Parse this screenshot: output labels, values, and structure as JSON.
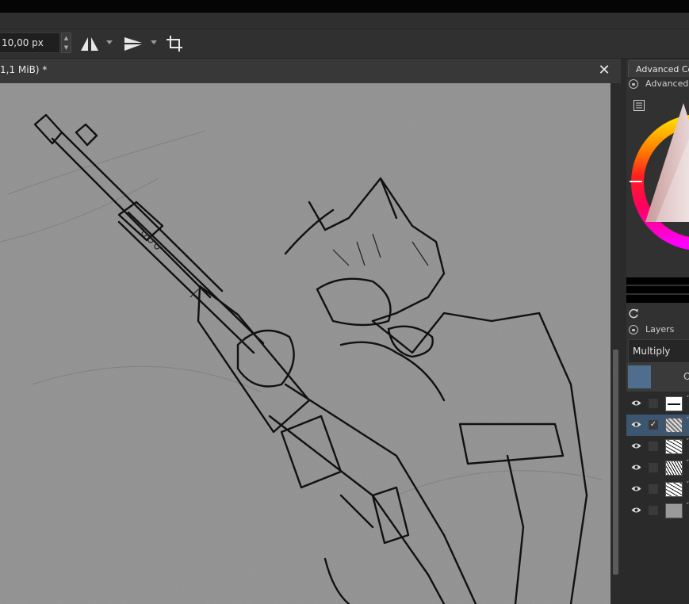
{
  "toolbar": {
    "brush_size_value": "10,00 px",
    "icons": [
      "mirror-horizontal-icon",
      "mirror-vertical-icon",
      "crop-icon"
    ]
  },
  "document": {
    "tab_title": "1,1 MiB) *",
    "close_glyph": "✕"
  },
  "docker": {
    "color_tab_label": "Advanced Co",
    "color_title": "Advanced C",
    "layers_title": "Layers",
    "blend_mode": "Multiply",
    "opacity_label": "O"
  },
  "layers": [
    {
      "visible": true,
      "checked": false,
      "selected": false,
      "thumb": "line"
    },
    {
      "visible": true,
      "checked": true,
      "selected": true,
      "thumb": "noise"
    },
    {
      "visible": true,
      "checked": false,
      "selected": false,
      "thumb": "sketch"
    },
    {
      "visible": true,
      "checked": false,
      "selected": false,
      "thumb": "sketch2"
    },
    {
      "visible": true,
      "checked": false,
      "selected": false,
      "thumb": "sketch"
    },
    {
      "visible": true,
      "checked": false,
      "selected": false,
      "thumb": "gray"
    }
  ],
  "colors": {
    "accent": "#4f6d8d",
    "selection": "#3d5670",
    "canvas": "#8e8e8e"
  }
}
